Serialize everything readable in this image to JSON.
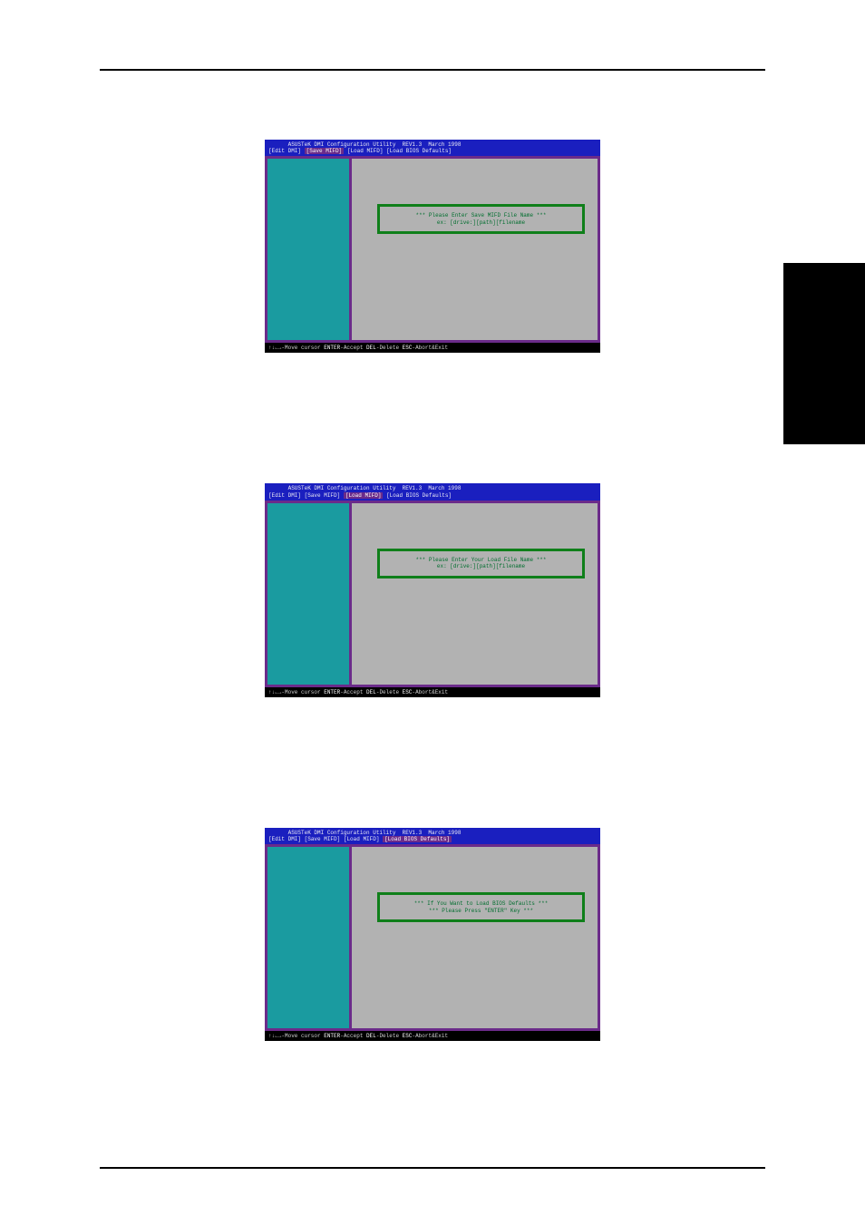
{
  "shots": [
    {
      "title": "ASUSTeK DMI Configuration Utility  REV1.3  March 1998",
      "tabs": [
        "[Edit DMI]",
        "[Save MIFD]",
        "[Load MIFD]",
        "[Load BIOS Defaults]"
      ],
      "activeTabIndex": 1,
      "prompt1": "*** Please Enter Save MIFD File Name ***",
      "prompt2": "ex: [drive:][path][filename",
      "status_pre": "↑↓←→-Move cursor ",
      "status_k1": "ENTER",
      "status_mid1": "-Accept ",
      "status_k2": "DEL",
      "status_mid2": "-Delete ",
      "status_k3": "ESC",
      "status_post": "-Abort&Exit"
    },
    {
      "title": "ASUSTeK DMI Configuration Utility  REV1.3  March 1998",
      "tabs": [
        "[Edit DMI]",
        "[Save MIFD]",
        "[Load MIFD]",
        "[Load BIOS Defaults]"
      ],
      "activeTabIndex": 2,
      "prompt1": "*** Please Enter Your Load File Name ***",
      "prompt2": "ex: [drive:][path][filename",
      "status_pre": "↑↓←→-Move cursor ",
      "status_k1": "ENTER",
      "status_mid1": "-Accept ",
      "status_k2": "DEL",
      "status_mid2": "-Delete ",
      "status_k3": "ESC",
      "status_post": "-Abort&Exit"
    },
    {
      "title": "ASUSTeK DMI Configuration Utility  REV1.3  March 1998",
      "tabs": [
        "[Edit DMI]",
        "[Save MIFD]",
        "[Load MIFD]",
        "[Load BIOS Defaults]"
      ],
      "activeTabIndex": 3,
      "prompt1": "*** If You Want to Load BIOS Defaults ***",
      "prompt2": "*** Please Press \"ENTER\" Key ***",
      "status_pre": "↑↓←→-Move cursor ",
      "status_k1": "ENTER",
      "status_mid1": "-Accept ",
      "status_k2": "DEL",
      "status_mid2": "-Delete ",
      "status_k3": "ESC",
      "status_post": "-Abort&Exit"
    }
  ]
}
